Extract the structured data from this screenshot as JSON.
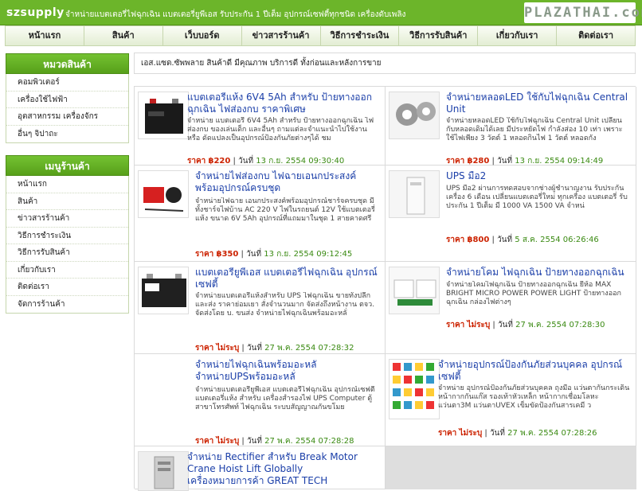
{
  "header": {
    "shop_name": "szsupply",
    "tagline": "จำหน่ายแบตเตอรี่ไฟฉุกเฉิน แบตเตอรี่ยูพีเอส รับประกัน 1 ปีเต็ม อุปกรณ์เซฟตี้ทุกชนิด เครื่องดับเพลิง",
    "brand": "PLAZATHAI.com"
  },
  "nav": [
    "หน้าแรก",
    "สินค้า",
    "เว็บบอร์ด",
    "ข่าวสารร้านค้า",
    "วิธีการชำระเงิน",
    "วิธีการรับสินค้า",
    "เกี่ยวกับเรา",
    "ติดต่อเรา"
  ],
  "sidebar": {
    "categories_title": "หมวดสินค้า",
    "categories": [
      "คอมพิวเตอร์",
      "เครื่องใช้ไฟฟ้า",
      "อุตสาหกรรม เครื่องจักร",
      "อื่นๆ จิปาถะ"
    ],
    "menu_title": "เมนูร้านค้า",
    "menu": [
      "หน้าแรก",
      "สินค้า",
      "ข่าวสารร้านค้า",
      "วิธีการชำระเงิน",
      "วิธีการรับสินค้า",
      "เกี่ยวกับเรา",
      "ติดต่อเรา",
      "จัดการร้านค้า"
    ]
  },
  "slogan": "เอส.แซด.ซัพพลาย สินค้าดี มีคุณภาพ บริการดี ทั้งก่อนและหลังการขาย",
  "price_label": "ราคา",
  "date_label": "วันที่",
  "products": [
    {
      "title": "แบตเตอรี่แห้ง 6V4 5Ah สำหรับ ป้ายทางออกฉุกเฉิน ไฟส่องกบ ราคาพิเศษ",
      "desc": "จำหน่าย แบตเตอรี่ 6V4 5Ah สำหรับ ป้ายทางออกฉุกเฉิน ไฟส่องกบ ของเล่นเด็ก และอื่นๆ ถามแต่ละจำแนะนำไปใช้งาน หรือ ดัดแปลงเป็นอุปกรณ์ป้องกันภัยต่างๆได้ ชม",
      "price": "฿220",
      "date": "13 ก.ย. 2554 09:30:40",
      "thumb": "battery-black"
    },
    {
      "title": "จำหน่ายหลอดLED ใช้กับไฟฉุกเฉิน Central Unit",
      "desc": "จำหน่ายหลอดLED ใช้กับไฟฉุกเฉิน Central Unit เปลี่ยนกับหลอดเดิมได้เลย มีประหยัดไฟ กำลังส่อง 10 เท่า เพราะใช้ไฟเพียง 3 วัตต์ 1 หลอดกินไฟ 1 วัตต์ หลอดกัง",
      "price": "฿280",
      "date": "13 ก.ย. 2554 09:14:49",
      "thumb": "led-bulbs"
    },
    {
      "title": "จำหน่ายไฟส่องกบ ไฟฉายเอนกประสงค์ พร้อมอุปกรณ์ครบชุด",
      "desc": "จำหน่ายไฟฉาย เอนกประสงค์พร้อมอุปกรณ์ชาร์จครบชุด มีทั้งชาร์จไฟบ้าน AC 220 V ไฟในรถยนต์ 12V ใช้แบตเตอรี่แห้ง ขนาด 6V 5Ah อุปกรณ์ที่แถมมาในชุด 1 สายคาดศรี",
      "price": "฿350",
      "date": "13 ก.ย. 2554 09:12:45",
      "thumb": "lamp-kit"
    },
    {
      "title": "UPS มือ2",
      "desc": "UPS มือ2 ผ่านการทดสอบจากช่างผู้ชำนาญงาน รับประกันเครื่อง 6 เดือน เปลี่ยนแบตเตอรี่ใหม่ ทุกเครื่อง แบตเตอรี่ รับประกัน 1 ปีเต็ม มี 1000 VA 1500 VA จำหน่",
      "price": "฿800",
      "date": "5 ส.ค. 2554 06:26:46",
      "thumb": "ups-white"
    },
    {
      "title": "แบตเตอรี่ยูพีเอส แบตเตอรี่ไฟฉุกเฉิน อุปกรณ์เซฟตี้",
      "desc": "จำหน่ายแบตเตอรี่แห้งสำหรับ UPS ไฟฉุกเฉิน ขายทั้งปลีกและส่ง ราคาย่อมเยา สั่งจำนวนมาก จัดส่งถึงหน้างาน ตจว. จัดส่งโดย บ. ขนส่ง จำหน่ายไฟฉุกเฉินพร้อมอะหลั่",
      "price": "ไม่ระบุ",
      "date": "27 พ.ค. 2554 07:28:32",
      "thumb": "battery-spa"
    },
    {
      "title": "จำหน่ายโคม ไฟฉุกเฉิน ป้ายทางออกฉุกเฉิน",
      "desc": "จำหน่ายโคมไฟฉุกเฉิน ป้ายทางออกฉุกเฉิน ยี่ห้อ MAX BRIGHT MICRO POWER POWER LIGHT ป้ายทางออกฉุกเฉิน กล่องไฟต่างๆ",
      "price": "ไม่ระบุ",
      "date": "27 พ.ค. 2554 07:28:30",
      "thumb": "emergency-lights"
    },
    {
      "title": "จำหน่ายไฟฉุกเฉินพร้อมอะหลั่ จำหน่ายUPSพร้อมอะหลั่",
      "desc": "จำหน่ายแบตเตอรี่ยูพีเอส แบตเตอรี่ไฟฉุกเฉิน อุปกรณ์เซฟตี้ แบตเตอรี่แห้ง สำหรับ เครื่องสำรองไฟ UPS Computer ตู้สาขาโทรศัพท์ ไฟฉุกเฉิน ระบบสัญญาณกันขโมย",
      "price": "ไม่ระบุ",
      "date": "27 พ.ค. 2554 07:28:28",
      "thumb": "emergency-units"
    },
    {
      "title": "จำหน่ายอุปกรณ์ป้องกันภัยส่วนบุคคล อุปกรณ์เซฟตี้",
      "desc": "จำหน่าย อุปกรณ์ป้องกันภัยส่วนบุคคล ถุงมือ แว่นตากันกระเด็น หน้ากากกันแก๊ส รองเท้าหัวเหล็ก หน้ากากเชื่อมโลหะ แว่นตา3M แว่นตาUVEX เข็มขัดป้องกันสารเคมี ว",
      "price": "ไม่ระบุ",
      "date": "27 พ.ค. 2554 07:28:26",
      "thumb": "safety-chart"
    },
    {
      "title": "จำหน่าย Rectifier สำหรับ Break Motor Crane Hoist Lift Globally เครื่องหมายการค้า GREAT TECH",
      "desc": "",
      "price": "",
      "date": "",
      "thumb": "rectifier"
    }
  ]
}
